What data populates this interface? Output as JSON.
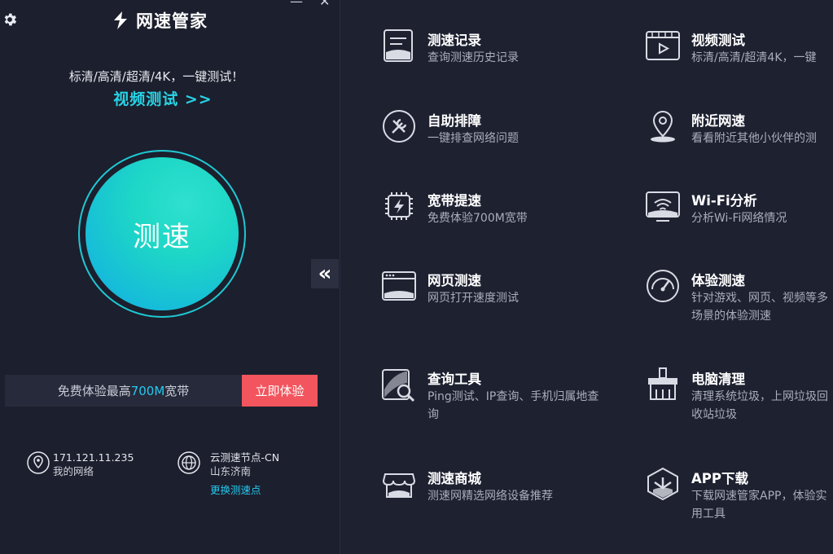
{
  "app": {
    "brand_name": "网速管家"
  },
  "window": {
    "minimize": "—",
    "close": "✕"
  },
  "promo": {
    "line": "标清/高清/超清/4K，一键测试！",
    "link": "视频测试 >>"
  },
  "speed_button": {
    "label": "测速"
  },
  "collapse": {
    "label": "«"
  },
  "offer": {
    "text_before": "免费体验最高",
    "highlight": "700M",
    "text_after": "宽带",
    "button": "立即体验"
  },
  "network": {
    "ip": "171.121.11.235",
    "ip_label": "我的网络",
    "node": "云测速节点-CN",
    "region": "山东济南",
    "change_node": "更换测速点"
  },
  "features": [
    {
      "title": "测速记录",
      "desc": "查询测速历史记录",
      "icon": "record-icon"
    },
    {
      "title": "视频测试",
      "desc": "标清/高清/超清4K，一键",
      "icon": "video-icon"
    },
    {
      "title": "自助排障",
      "desc": "一键排查网络问题",
      "icon": "tools-icon"
    },
    {
      "title": "附近网速",
      "desc": "看看附近其他小伙伴的测",
      "icon": "location-icon"
    },
    {
      "title": "宽带提速",
      "desc": "免费体验700M宽带",
      "icon": "chip-icon"
    },
    {
      "title": "Wi-Fi分析",
      "desc": "分析Wi-Fi网络情况",
      "icon": "wifi-icon"
    },
    {
      "title": "网页测速",
      "desc": "网页打开速度测试",
      "icon": "browser-icon"
    },
    {
      "title": "体验测速",
      "desc": "针对游戏、网页、视频等多场景的体验测速",
      "icon": "gauge-icon"
    },
    {
      "title": "查询工具",
      "desc": "Ping测试、IP查询、手机归属地查询",
      "icon": "search-tool-icon"
    },
    {
      "title": "电脑清理",
      "desc": "清理系统垃圾，上网垃圾回收站垃圾",
      "icon": "broom-icon"
    },
    {
      "title": "测速商城",
      "desc": "测速网精选网络设备推荐",
      "icon": "shop-icon"
    },
    {
      "title": "APP下载",
      "desc": "下载网速管家APP，体验实用工具",
      "icon": "app-download-icon"
    }
  ]
}
